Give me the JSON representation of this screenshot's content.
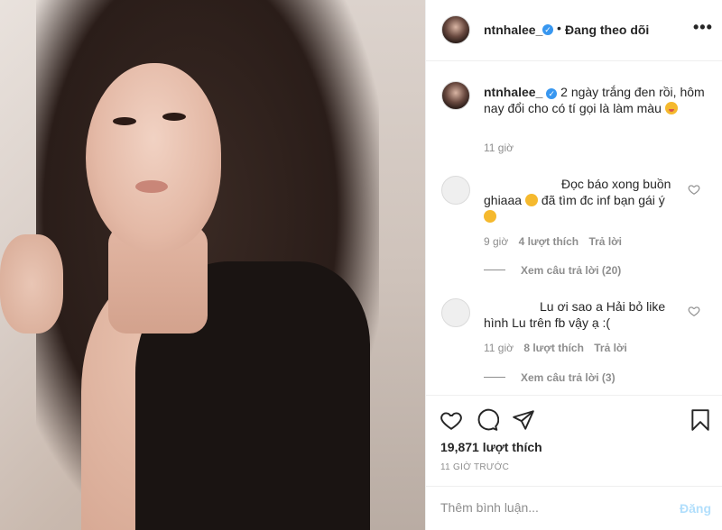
{
  "post": {
    "username": "ntnhalee_",
    "follow_status": "Đang theo dõi",
    "more_icon": "more-dots-icon"
  },
  "caption": {
    "username": "ntnhalee_",
    "text": "2 ngày trắng đen rồi, hôm nay đổi cho có tí gọi là làm màu",
    "time": "11 giờ"
  },
  "comments": [
    {
      "text_line1": "Đọc báo xong buồn",
      "text_line2": "ghiaaa",
      "text_line2b": "đã tìm đc inf bạn gái ý",
      "time": "9 giờ",
      "likes": "4 lượt thích",
      "reply": "Trả lời",
      "view_replies": "Xem câu trả lời (20)"
    },
    {
      "text_line1": "Lu ơi sao a Hải bỏ like",
      "text_line2": "hình Lu trên fb vậy ạ :(",
      "time": "11 giờ",
      "likes": "8 lượt thích",
      "reply": "Trả lời",
      "view_replies": "Xem câu trả lời (3)"
    }
  ],
  "actions": {
    "likes": "19,871 lượt thích",
    "posted_ago": "11 GIỜ TRƯỚC",
    "comment_placeholder": "Thêm bình luận...",
    "post_label": "Đăng"
  },
  "colors": {
    "verified": "#3897f0",
    "muted": "#8e8e8e",
    "post_disabled": "#b2dffc"
  }
}
